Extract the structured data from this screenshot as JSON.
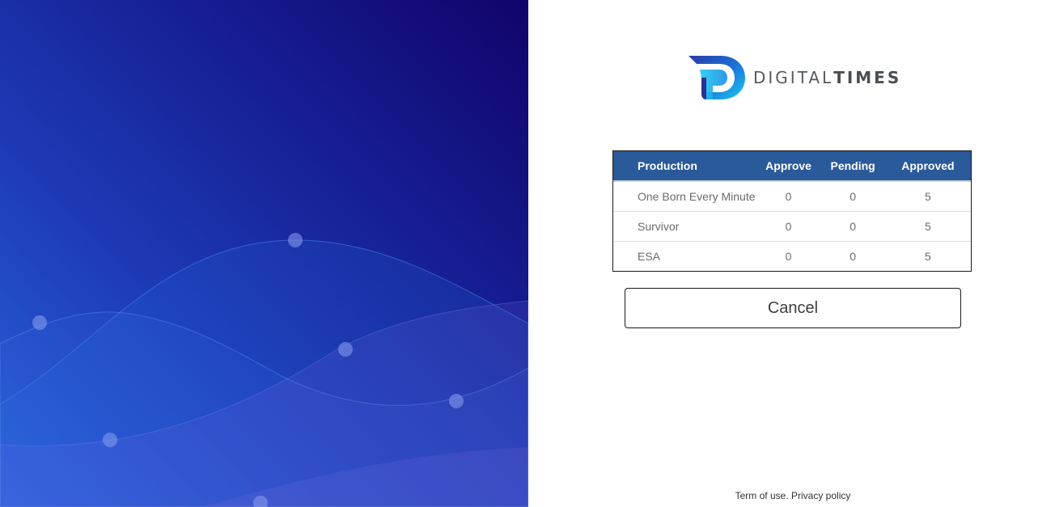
{
  "brand": {
    "name_light": "DIGITAL",
    "name_bold": "TIMES",
    "colors": {
      "accent_cyan": "#1ec8f0",
      "accent_blue": "#1a6fd6",
      "accent_purple": "#3a2a9c",
      "text": "#555a60"
    }
  },
  "table": {
    "header_color": "#2a5a9a",
    "columns": [
      "Production",
      "Approve",
      "Pending",
      "Approved"
    ],
    "rows": [
      {
        "production": "One Born Every Minute",
        "approve": "0",
        "pending": "0",
        "approved": "5"
      },
      {
        "production": "Survivor",
        "approve": "0",
        "pending": "0",
        "approved": "5"
      },
      {
        "production": "ESA",
        "approve": "0",
        "pending": "0",
        "approved": "5"
      }
    ]
  },
  "actions": {
    "cancel_label": "Cancel"
  },
  "footer": {
    "terms_label": "Term of use.",
    "privacy_label": "Privacy policy"
  },
  "hero": {
    "gradient": [
      "#11046a",
      "#151b8f",
      "#1d3bb6",
      "#2b63de"
    ]
  }
}
